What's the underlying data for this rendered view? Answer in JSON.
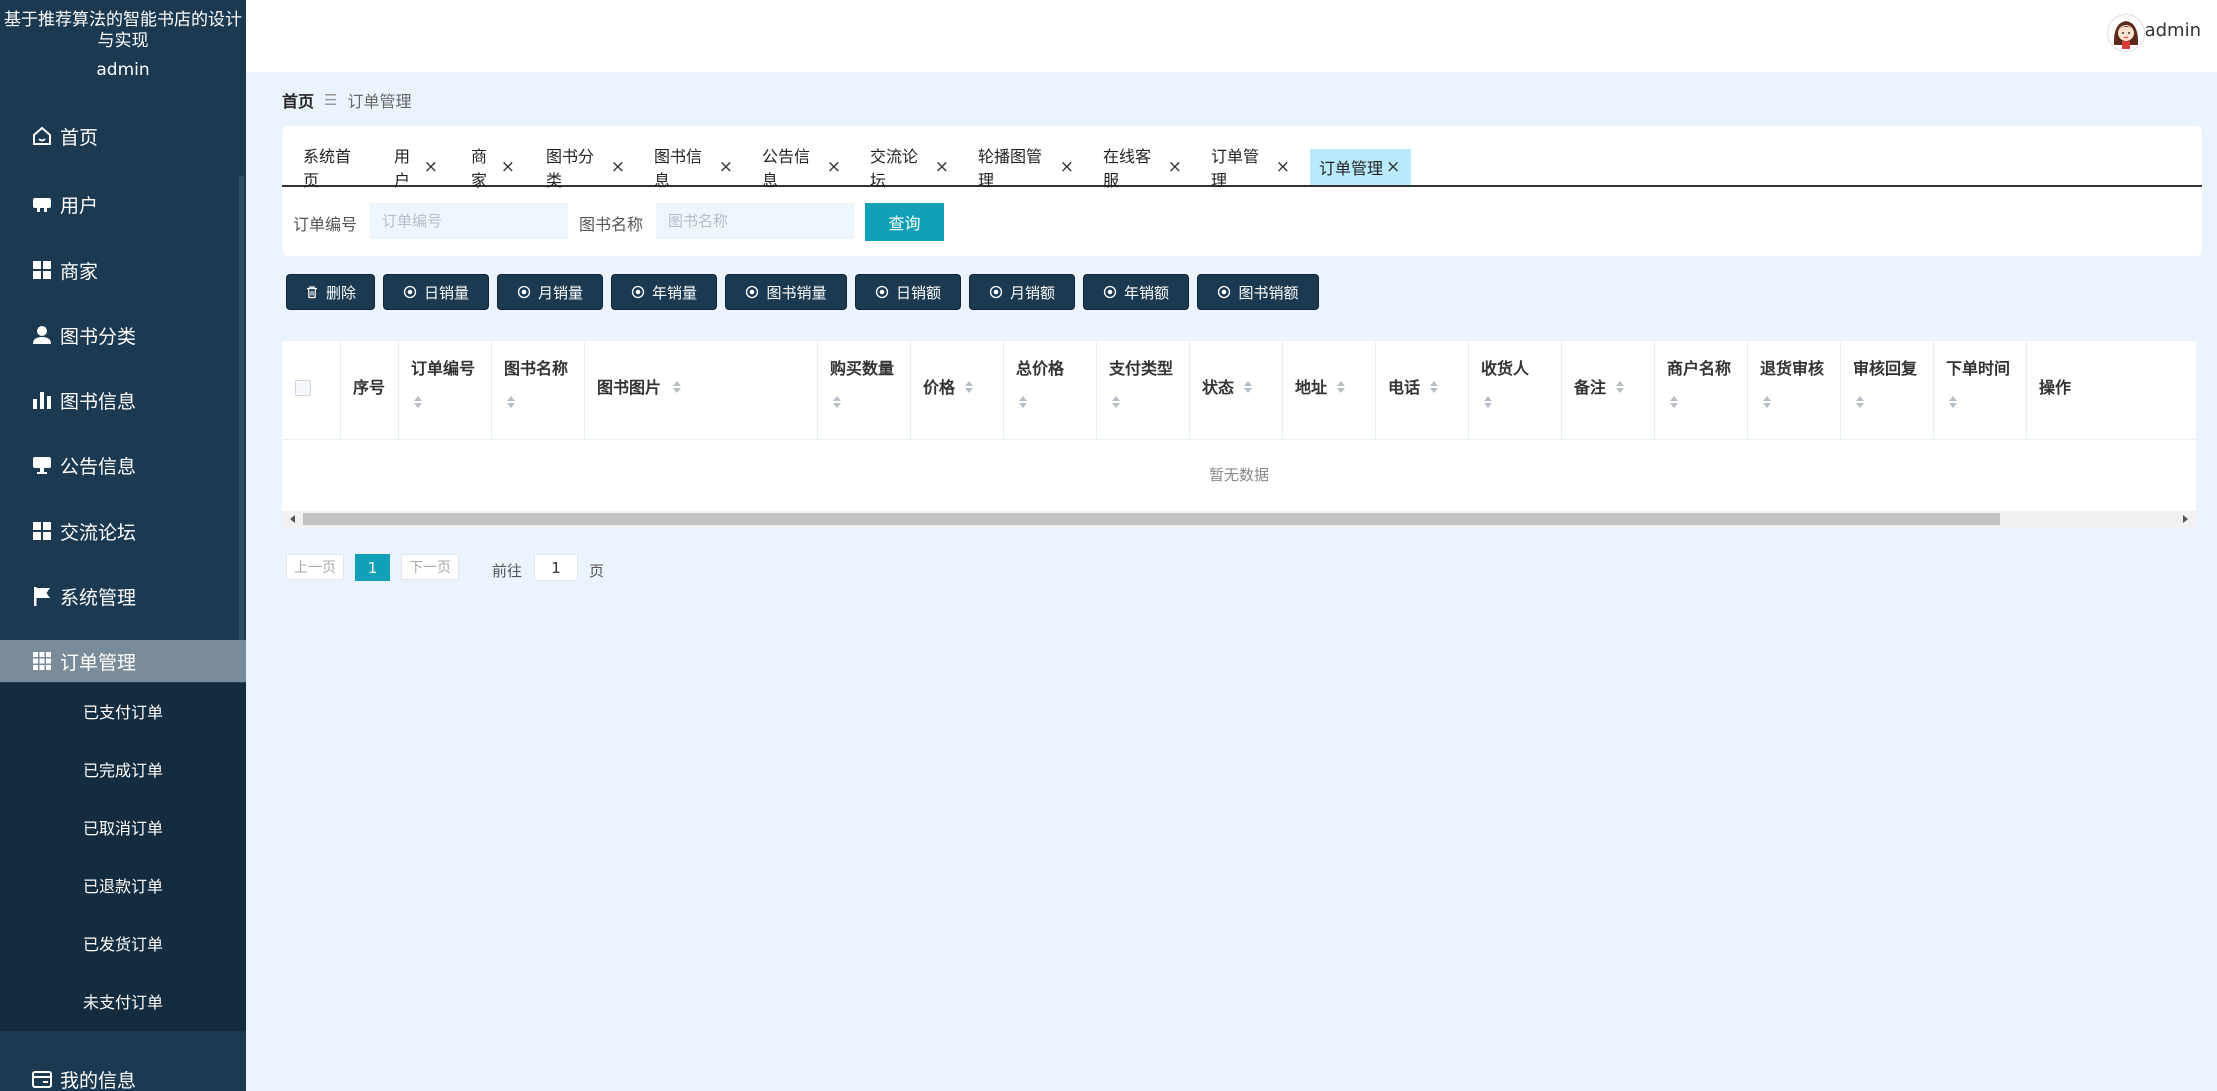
{
  "app": {
    "title": "基于推荐算法的智能书店的设计与实现",
    "sidebar_user": "admin"
  },
  "sidebar": {
    "items": [
      {
        "label": "首页",
        "icon": "home-icon"
      },
      {
        "label": "用户",
        "icon": "user-monitor-icon"
      },
      {
        "label": "商家",
        "icon": "grid-icon"
      },
      {
        "label": "图书分类",
        "icon": "person-icon"
      },
      {
        "label": "图书信息",
        "icon": "bar-chart-icon"
      },
      {
        "label": "公告信息",
        "icon": "monitor-icon"
      },
      {
        "label": "交流论坛",
        "icon": "grid-icon"
      },
      {
        "label": "系统管理",
        "icon": "flag-icon"
      },
      {
        "label": "订单管理",
        "icon": "apps-icon"
      },
      {
        "label": "我的信息",
        "icon": "card-icon"
      }
    ],
    "submenu": [
      "已支付订单",
      "已完成订单",
      "已取消订单",
      "已退款订单",
      "已发货订单",
      "未支付订单"
    ]
  },
  "header": {
    "username": "admin"
  },
  "breadcrumb": {
    "home": "首页",
    "separator": "☰",
    "current": "订单管理"
  },
  "tabs": [
    {
      "label": "系统首页",
      "closable": false
    },
    {
      "label": "用户",
      "closable": true
    },
    {
      "label": "商家",
      "closable": true
    },
    {
      "label": "图书分类",
      "closable": true
    },
    {
      "label": "图书信息",
      "closable": true
    },
    {
      "label": "公告信息",
      "closable": true
    },
    {
      "label": "交流论坛",
      "closable": true
    },
    {
      "label": "轮播图管理",
      "closable": true
    },
    {
      "label": "在线客服",
      "closable": true
    },
    {
      "label": "订单管理",
      "closable": true
    },
    {
      "label": "订单管理",
      "closable": true,
      "active": true
    }
  ],
  "tab_close_symbol": "×",
  "search": {
    "order_no_label": "订单编号",
    "order_no_placeholder": "订单编号",
    "order_no_value": "",
    "book_name_label": "图书名称",
    "book_name_placeholder": "图书名称",
    "book_name_value": "",
    "query_label": "查询"
  },
  "actions": [
    {
      "label": "删除",
      "icon": "trash-icon"
    },
    {
      "label": "日销量",
      "icon": "radio-icon"
    },
    {
      "label": "月销量",
      "icon": "radio-icon"
    },
    {
      "label": "年销量",
      "icon": "radio-icon"
    },
    {
      "label": "图书销量",
      "icon": "radio-icon"
    },
    {
      "label": "日销额",
      "icon": "radio-icon"
    },
    {
      "label": "月销额",
      "icon": "radio-icon"
    },
    {
      "label": "年销额",
      "icon": "radio-icon"
    },
    {
      "label": "图书销额",
      "icon": "radio-icon"
    }
  ],
  "table": {
    "columns": [
      {
        "label": "序号",
        "sortable": false
      },
      {
        "label": "订单编号",
        "sortable": true
      },
      {
        "label": "图书名称",
        "sortable": true
      },
      {
        "label": "图书图片",
        "sortable": true
      },
      {
        "label": "购买数量",
        "sortable": true
      },
      {
        "label": "价格",
        "sortable": true
      },
      {
        "label": "总价格",
        "sortable": true
      },
      {
        "label": "支付类型",
        "sortable": true
      },
      {
        "label": "状态",
        "sortable": true
      },
      {
        "label": "地址",
        "sortable": true
      },
      {
        "label": "电话",
        "sortable": true
      },
      {
        "label": "收货人",
        "sortable": true
      },
      {
        "label": "备注",
        "sortable": true
      },
      {
        "label": "商户名称",
        "sortable": true
      },
      {
        "label": "退货审核",
        "sortable": true
      },
      {
        "label": "审核回复",
        "sortable": true
      },
      {
        "label": "下单时间",
        "sortable": true
      },
      {
        "label": "操作",
        "sortable": false
      }
    ],
    "rows": [],
    "empty_text": "暂无数据"
  },
  "pagination": {
    "prev_label": "上一页",
    "current_page": "1",
    "next_label": "下一页",
    "goto_label": "前往",
    "goto_value": "1",
    "page_suffix": "页"
  },
  "colors": {
    "sidebar_bg": "#1b3a52",
    "accent": "#11a0b7",
    "active_tab": "#b8eafc",
    "page_bg": "#ebf4fe"
  }
}
